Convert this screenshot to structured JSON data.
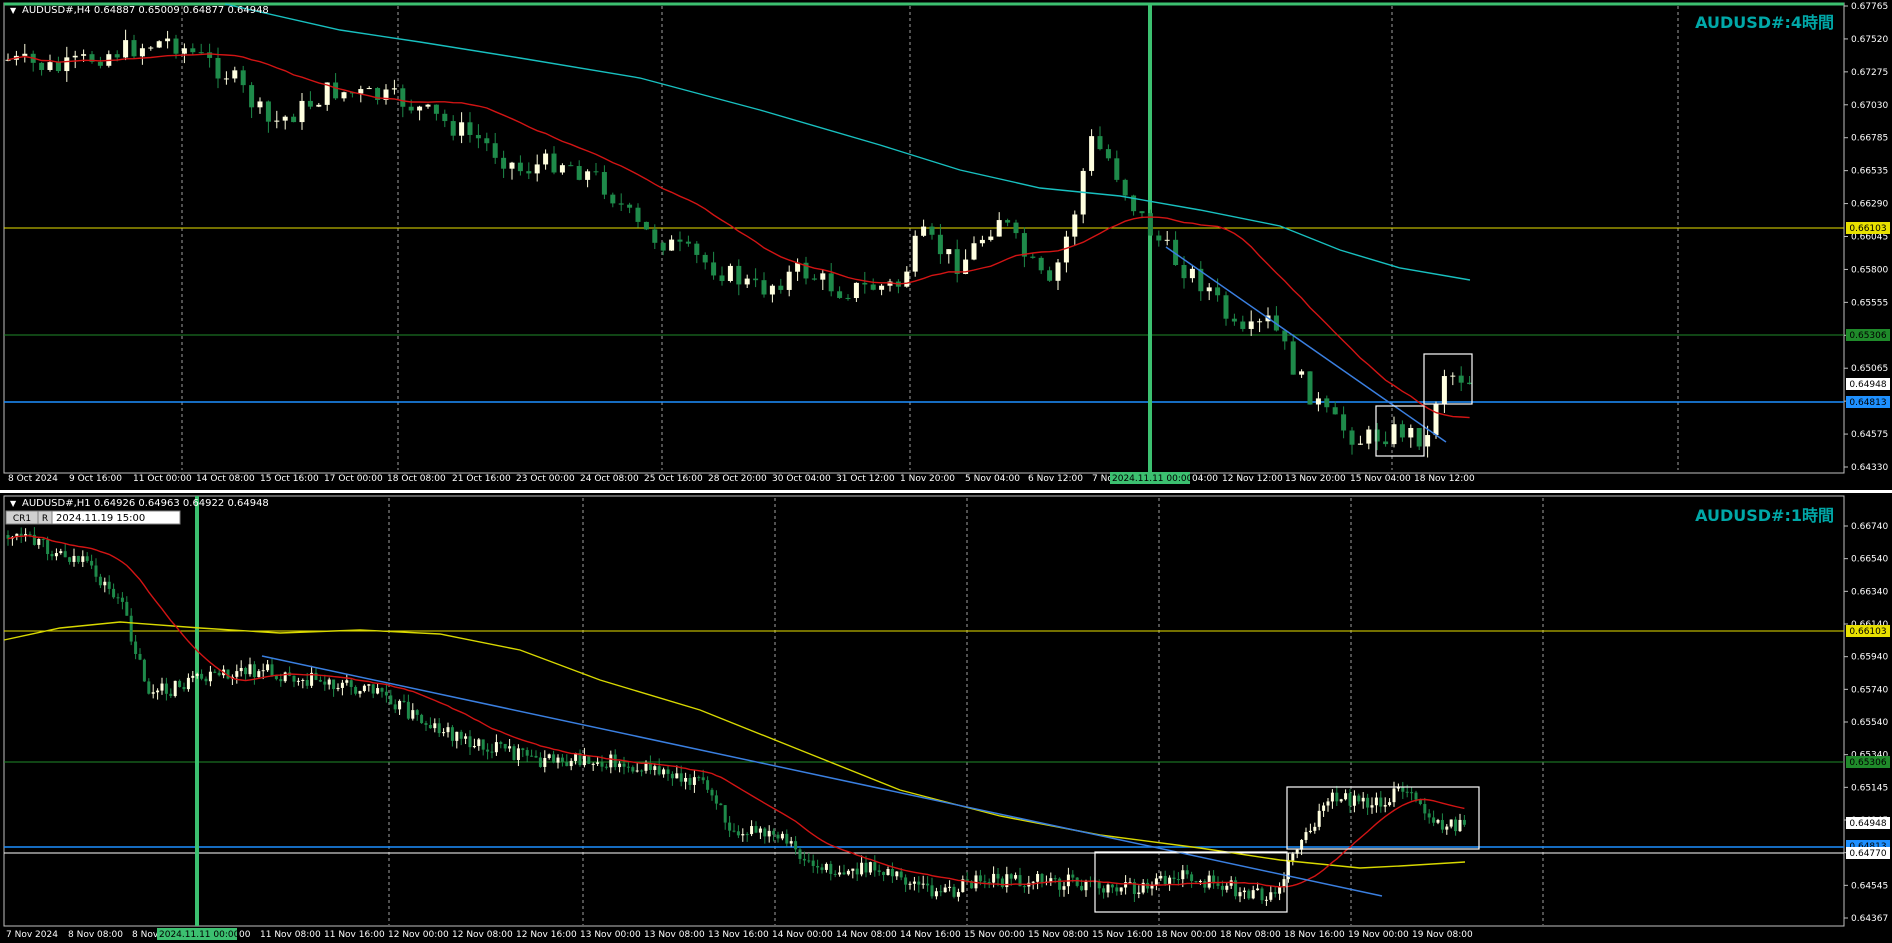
{
  "colors": {
    "background": "#000000",
    "grid": "#a0a0a0",
    "frame": "#c0c0c0",
    "bull_candle": "#ffffe0",
    "bear_candle": "#1e8a4a",
    "ma_fast": "#d21414",
    "ma_slow_h4": "#18c0c0",
    "ma_slow_h1": "#d8d800",
    "trendline": "#3a7fe0",
    "level_yellow": "#e8e000",
    "level_green": "#1f8a2a",
    "level_blue": "#1e90ff",
    "vline_green": "#3cc070",
    "title_teal": "#00a8a8",
    "axis_text": "#ffffff"
  },
  "panel_h4": {
    "info": "AUDUSD#,H4 0.64887 0.65009 0.64877 0.64948",
    "watermark": "AUDUSD#:4時間",
    "price_labels": [
      "0.67765",
      "0.67520",
      "0.67275",
      "0.67030",
      "0.66785",
      "0.66535",
      "0.66290",
      "0.66045",
      "0.65800",
      "0.65555",
      "0.65310",
      "0.65065",
      "0.64820",
      "0.64575",
      "0.64330"
    ],
    "time_labels": [
      "8 Oct 2024",
      "9 Oct 16:00",
      "11 Oct 00:00",
      "14 Oct 08:00",
      "15 Oct 16:00",
      "17 Oct 00:00",
      "18 Oct 08:00",
      "21 Oct 16:00",
      "23 Oct 00:00",
      "24 Oct 08:00",
      "25 Oct 16:00",
      "28 Oct 20:00",
      "30 Oct 04:00",
      "31 Oct 12:00",
      "1 Nov 20:00",
      "5 Nov 04:00",
      "6 Nov 12:00",
      "7 Nov",
      "12 Nov 12:00",
      "13 Nov 20:00",
      "15 Nov 04:00",
      "18 Nov 12:00"
    ],
    "time_highlight": "2024.11.11 00:00",
    "time_highlight_after": "04:00",
    "level_yellow_label": "0.66103",
    "level_green_label": "0.65306",
    "current_price_label": "0.64948",
    "level_blue_label": "0.64813"
  },
  "panel_h1": {
    "info": "AUDUSD#,H1 0.64926 0.64963 0.64922 0.64948",
    "watermark": "AUDUSD#:1時間",
    "badge_cr": "CR1",
    "badge_r": "R",
    "crosshair_time": "2024.11.19 15:00",
    "price_labels": [
      "0.66740",
      "0.66540",
      "0.66340",
      "0.66140",
      "0.65940",
      "0.65740",
      "0.65540",
      "0.65340",
      "0.65145",
      "0.64945",
      "0.64745",
      "0.64545",
      "0.64367"
    ],
    "time_labels": [
      "7 Nov 2024",
      "8 Nov 08:00",
      "8 Nov",
      "11 Nov 08:00",
      "11 Nov 16:00",
      "12 Nov 00:00",
      "12 Nov 08:00",
      "12 Nov 16:00",
      "13 Nov 00:00",
      "13 Nov 08:00",
      "13 Nov 16:00",
      "14 Nov 00:00",
      "14 Nov 08:00",
      "14 Nov 16:00",
      "15 Nov 00:00",
      "15 Nov 08:00",
      "15 Nov 16:00",
      "18 Nov 00:00",
      "18 Nov 08:00",
      "18 Nov 16:00",
      "19 Nov 00:00",
      "19 Nov 08:00"
    ],
    "time_highlight": "2024.11.11 00:00",
    "time_highlight_after": "00",
    "level_yellow_label": "0.66103",
    "level_green_label": "0.65306",
    "current_price_label": "0.64948",
    "level_blue_label": "0.64813",
    "level_white_label": "0.64770"
  }
}
